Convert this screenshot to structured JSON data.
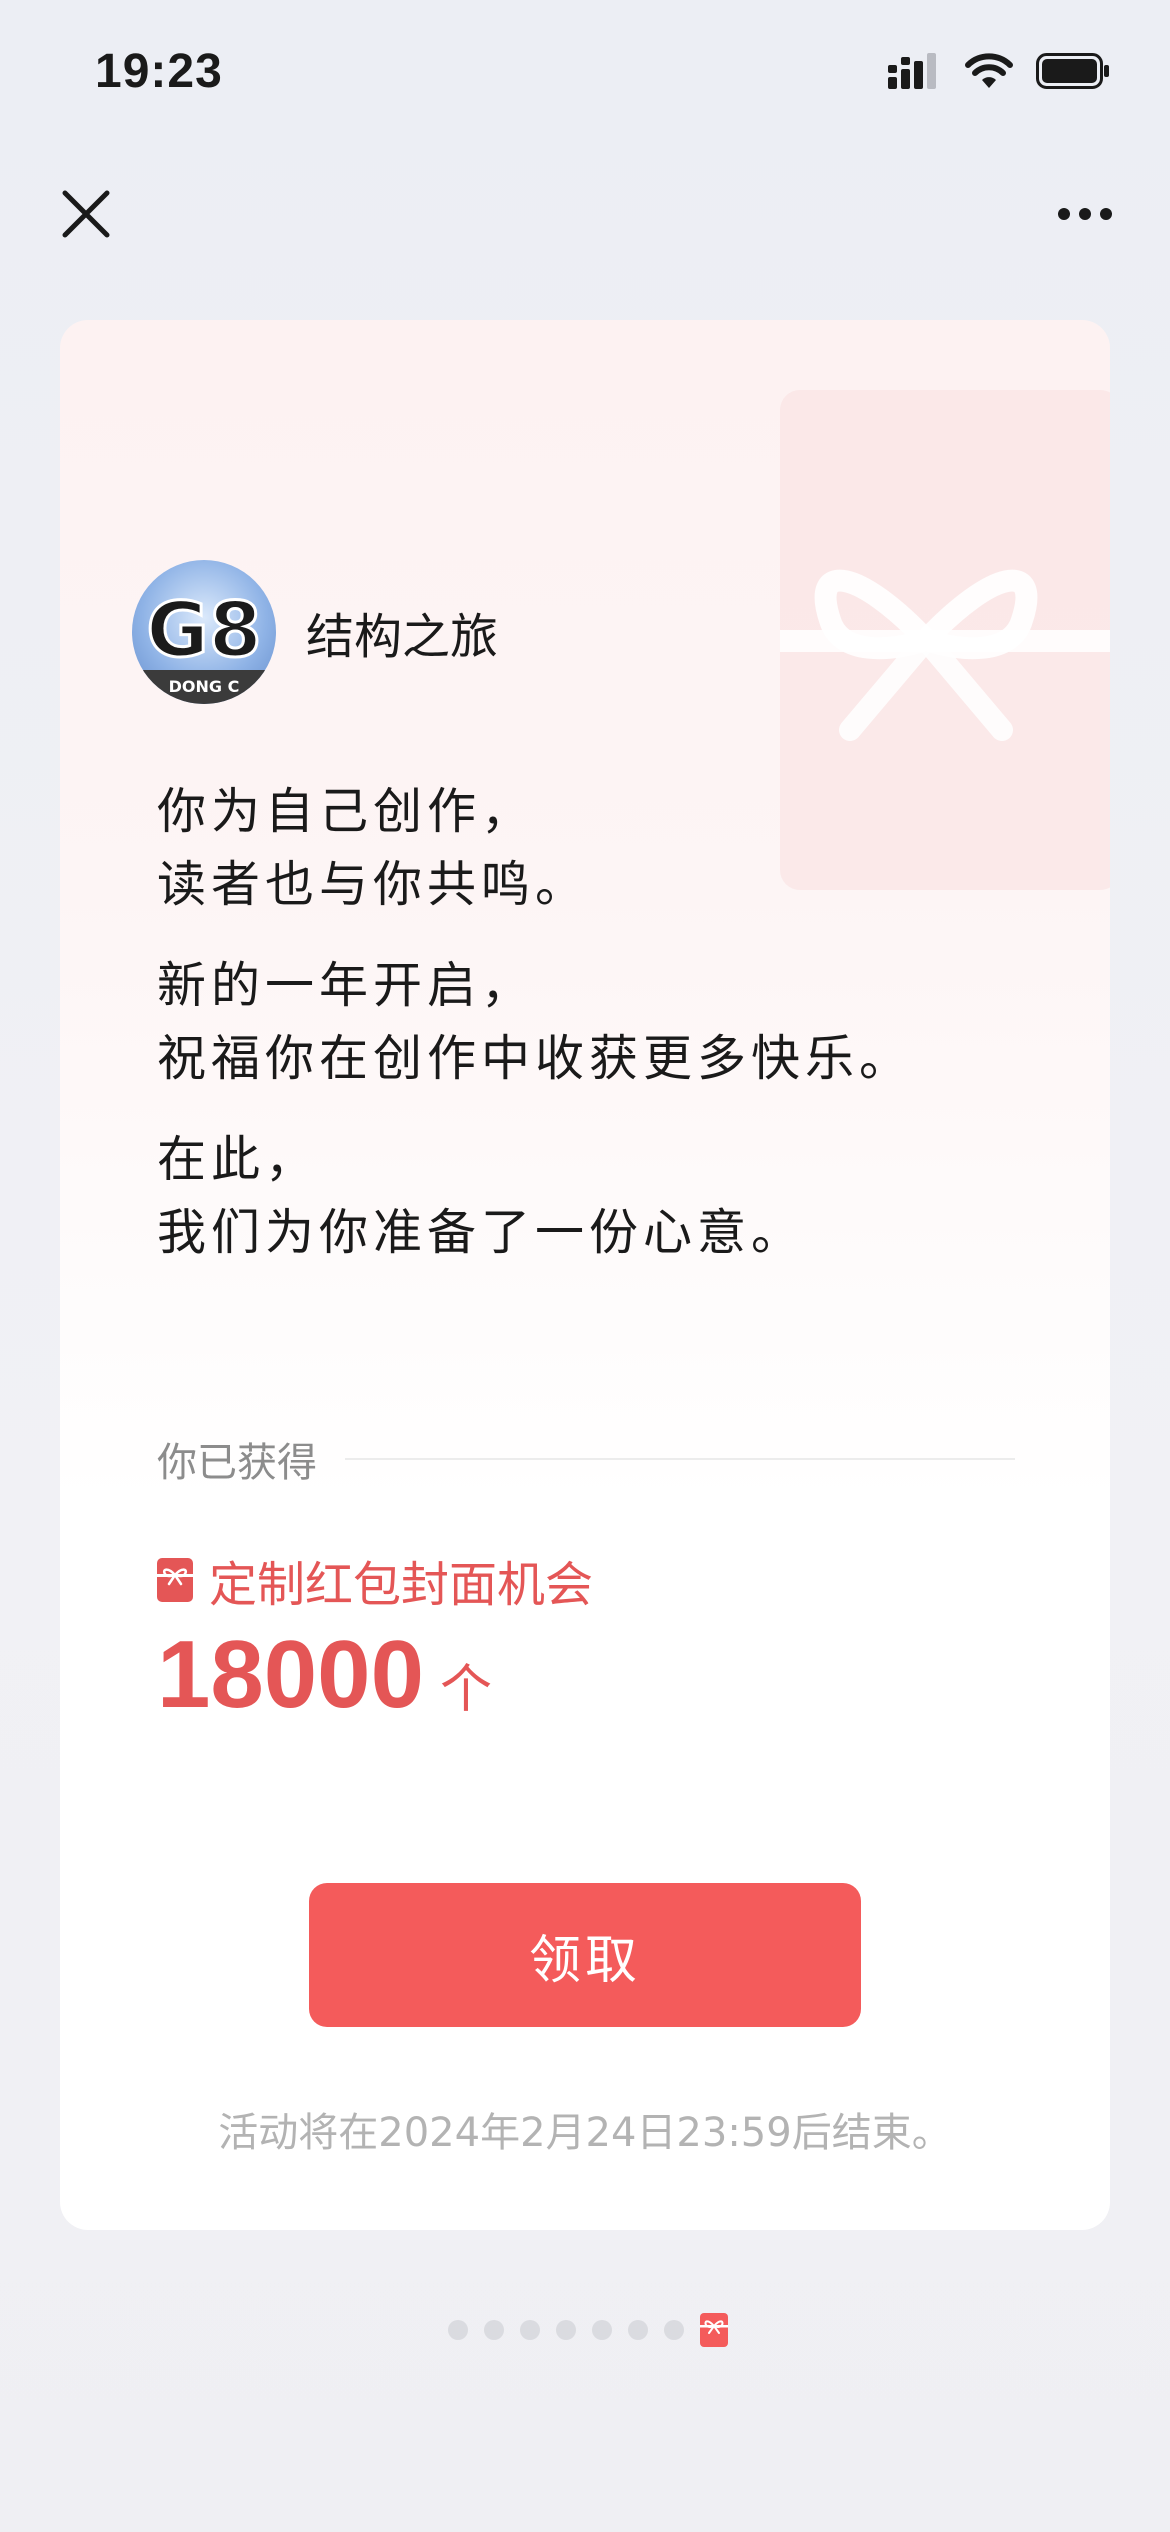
{
  "status_bar": {
    "time": "19:23"
  },
  "nav": {
    "close_icon": "close-icon",
    "more_icon": "more-dots-icon"
  },
  "card": {
    "author": {
      "name": "结构之旅",
      "avatar_text": "G8",
      "avatar_caption": "DONG C"
    },
    "message": [
      [
        "你为自己创作，",
        "读者也与你共鸣。"
      ],
      [
        "新的一年开启，",
        "祝福你在创作中收获更多快乐。"
      ],
      [
        "在此，",
        "我们为你准备了一份心意。"
      ]
    ],
    "earned_label": "你已获得",
    "prize": {
      "icon": "red-envelope-icon",
      "name": "定制红包封面机会",
      "count": "18000",
      "unit": "个"
    },
    "claim_button": "领取",
    "end_note": "活动将在2024年2月24日23:59后结束。"
  },
  "pager": {
    "total": 8,
    "active_index": 7
  },
  "colors": {
    "accent": "#F45B5B",
    "prize_text": "#E45656",
    "muted": "#8C8C8C"
  }
}
